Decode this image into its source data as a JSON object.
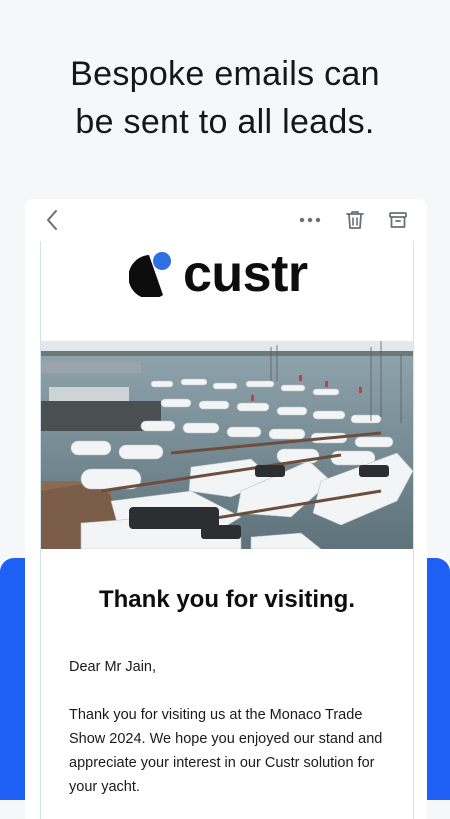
{
  "headline": {
    "line1": "Bespoke emails can",
    "line2": "be sent to all leads."
  },
  "toolbar": {
    "back_icon": "chevron-left-icon",
    "more_icon": "more-dots-icon",
    "trash_icon": "trash-icon",
    "archive_icon": "archive-icon"
  },
  "email": {
    "brand": "custr",
    "photo_alt": "Marina full of yachts",
    "heading": "Thank you for visiting.",
    "greeting": "Dear Mr Jain,",
    "paragraph": "Thank you for visiting us at the Monaco Trade Show 2024. We hope you enjoyed our stand and appreciate your interest in our Custr solution for your yacht."
  },
  "colors": {
    "accent": "#1e5ff5",
    "logo_dot": "#2f6fe4",
    "text": "#15171a"
  }
}
